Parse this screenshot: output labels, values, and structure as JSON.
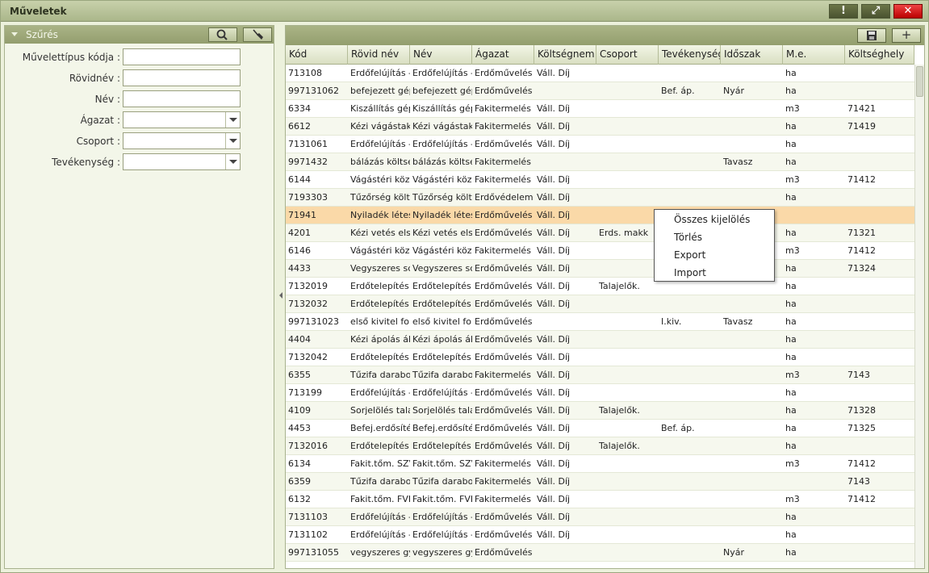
{
  "window": {
    "title": "Műveletek",
    "buttons": {
      "info": "!",
      "restore": "⤢",
      "close": "✕"
    }
  },
  "filter": {
    "header": "Szűrés",
    "fields": [
      {
        "label": "Művelettípus kódja :",
        "value": "",
        "type": "input"
      },
      {
        "label": "Rövidnév :",
        "value": "",
        "type": "input"
      },
      {
        "label": "Név :",
        "value": "",
        "type": "input"
      },
      {
        "label": "Ágazat :",
        "value": "",
        "type": "select"
      },
      {
        "label": "Csoport :",
        "value": "",
        "type": "select"
      },
      {
        "label": "Tevékenység :",
        "value": "",
        "type": "select"
      }
    ],
    "icons": {
      "search": "search-icon",
      "clear": "broom-icon"
    }
  },
  "grid": {
    "toolbar": {
      "save_icon": "save-icon",
      "add_label": "+"
    },
    "columns": [
      "Kód",
      "Rövid név",
      "Név",
      "Ágazat",
      "Költségnem",
      "Csoport",
      "Tevékenység",
      "Időszak",
      "M.e.",
      "Költséghely"
    ],
    "rows": [
      [
        "713108",
        "Erdőfelújítás - M",
        "Erdőfelújítás - M",
        "Erdőművelés",
        "Váll. Díj",
        "",
        "",
        "",
        "ha",
        ""
      ],
      [
        "997131062",
        "befejezett gépi",
        "befejezett gépi",
        "Erdőművelés",
        "",
        "",
        "Bef. áp.",
        "Nyár",
        "ha",
        ""
      ],
      [
        "6334",
        "Kiszállítás gépp",
        "Kiszállítás gépp",
        "Fakitermelés",
        "Váll. Díj",
        "",
        "",
        "",
        "m3",
        "71421"
      ],
      [
        "6612",
        "Kézi vágástaka",
        "Kézi vágástaka",
        "Fakitermelés",
        "Váll. Díj",
        "",
        "",
        "",
        "ha",
        "71419"
      ],
      [
        "7131061",
        "Erdőfelújítás - T",
        "Erdőfelújítás - T",
        "Erdőművelés",
        "Váll. Díj",
        "",
        "",
        "",
        "ha",
        ""
      ],
      [
        "9971432",
        "bálázás költség",
        "bálázás költség",
        "Fakitermelés",
        "",
        "",
        "",
        "Tavasz",
        "ha",
        ""
      ],
      [
        "6144",
        "Vágástéri köze",
        "Vágástéri köze",
        "Fakitermelés",
        "Váll. Díj",
        "",
        "",
        "",
        "m3",
        "71412"
      ],
      [
        "7193303",
        "Tűzőrség költs",
        "Tűzőrség költs",
        "Erdővédelem",
        "Váll. Díj",
        "",
        "",
        "",
        "ha",
        ""
      ],
      [
        "71941",
        "Nyiladék létesít",
        "Nyiladék létesít",
        "Erdőművelés",
        "Váll. Díj",
        "",
        "",
        "",
        "",
        ""
      ],
      [
        "4201",
        "Kézi vetés első",
        "Kézi vetés első",
        "Erdőművelés",
        "Váll. Díj",
        "Erds. makk",
        "",
        "",
        "ha",
        "71321"
      ],
      [
        "6146",
        "Vágástéri köze",
        "Vágástéri köze",
        "Fakitermelés",
        "Váll. Díj",
        "",
        "",
        "",
        "m3",
        "71412"
      ],
      [
        "4433",
        "Vegyszeres sc",
        "Vegyszeres sc",
        "Erdőművelés",
        "Váll. Díj",
        "",
        "",
        "",
        "ha",
        "71324"
      ],
      [
        "7132019",
        "Erdőtelepítés - ",
        "Erdőtelepítés - ",
        "Erdőművelés",
        "Váll. Díj",
        "Talajelők.",
        "",
        "",
        "ha",
        ""
      ],
      [
        "7132032",
        "Erdőtelepítés - ",
        "Erdőtelepítés - ",
        "Erdőművelés",
        "Váll. Díj",
        "",
        "",
        "",
        "ha",
        ""
      ],
      [
        "997131023",
        "első kivitel forg",
        "első kivitel forg",
        "Erdőművelés",
        "",
        "",
        "I.kiv.",
        "Tavasz",
        "ha",
        ""
      ],
      [
        "4404",
        "Kézi ápolás áll.",
        "Kézi ápolás állo",
        "Erdőművelés",
        "Váll. Díj",
        "",
        "",
        "",
        "ha",
        ""
      ],
      [
        "7132042",
        "Erdőtelepítés - ",
        "Erdőtelepítés - ",
        "Erdőművelés",
        "Váll. Díj",
        "",
        "",
        "",
        "ha",
        ""
      ],
      [
        "6355",
        "Tűzifa darabolá",
        "Tűzifa darabolá",
        "Fakitermelés",
        "Váll. Díj",
        "",
        "",
        "",
        "m3",
        "7143"
      ],
      [
        "713199",
        "Erdőfelújítás - A",
        "Erdőfelújítás - E",
        "Erdőművelés",
        "Váll. Díj",
        "",
        "",
        "",
        "ha",
        ""
      ],
      [
        "4109",
        "Sorjelölés talaje",
        "Sorjelölés talaje",
        "Erdőművelés",
        "Váll. Díj",
        "Talajelők.",
        "",
        "",
        "ha",
        "71328"
      ],
      [
        "4453",
        "Befej.erdősítés",
        "Befej.erdősítés",
        "Erdőművelés",
        "Váll. Díj",
        "",
        "Bef. áp.",
        "",
        "ha",
        "71325"
      ],
      [
        "7132016",
        "Erdőtelepítés - ",
        "Erdőtelepítés - ",
        "Erdőművelés",
        "Váll. Díj",
        "Talajelők.",
        "",
        "",
        "ha",
        ""
      ],
      [
        "6134",
        "Fakit.tőm. SZV",
        "Fakit.tőm. SZV",
        "Fakitermelés",
        "Váll. Díj",
        "",
        "",
        "",
        "m3",
        "71412"
      ],
      [
        "6359",
        "Tűzifa darabolá",
        "Tűzifa darabolá",
        "Fakitermelés",
        "Váll. Díj",
        "",
        "",
        "",
        "",
        "7143"
      ],
      [
        "6132",
        "Fakit.tőm. FVB",
        "Fakit.tőm. FVB",
        "Fakitermelés",
        "Váll. Díj",
        "",
        "",
        "",
        "m3",
        "71412"
      ],
      [
        "7131103",
        "Erdőfelújítás - A",
        "Erdőfelújítás - A",
        "Erdőművelés",
        "Váll. Díj",
        "",
        "",
        "",
        "ha",
        ""
      ],
      [
        "7131102",
        "Erdőfelújítás - I",
        "Erdőfelújítás - E",
        "Erdőművelés",
        "Váll. Díj",
        "",
        "",
        "",
        "ha",
        ""
      ],
      [
        "997131055",
        "vegyszeres gy",
        "vegyszeres gy",
        "Erdőművelés",
        "",
        "",
        "",
        "Nyár",
        "ha",
        ""
      ]
    ],
    "selected_row": 8
  },
  "context_menu": {
    "items": [
      "Összes kijelölés",
      "Törlés",
      "Export",
      "Import"
    ]
  }
}
